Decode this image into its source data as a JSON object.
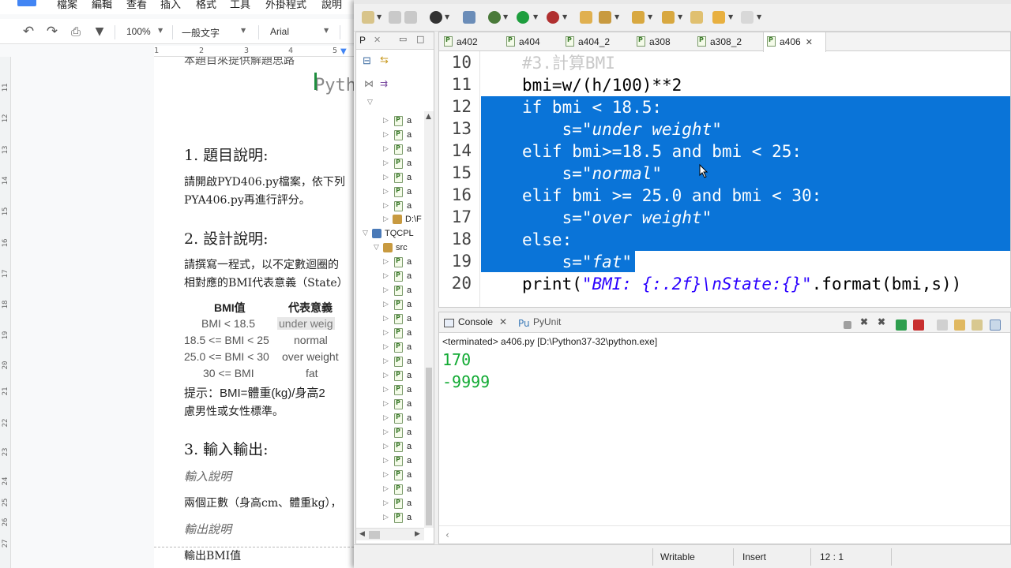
{
  "docs": {
    "menu": [
      "檔案",
      "編輯",
      "查看",
      "插入",
      "格式",
      "工具",
      "外掛程式",
      "說明"
    ],
    "toolbar": {
      "zoom": "100%",
      "style": "一般文字",
      "font": "Arial"
    },
    "ruler_numbers": [
      "1",
      "2",
      "3",
      "4",
      "5"
    ],
    "vruler_numbers": [
      "11",
      "12",
      "13",
      "14",
      "15",
      "16",
      "17",
      "18",
      "19",
      "20",
      "21",
      "22",
      "23",
      "24",
      "25",
      "26",
      "27"
    ],
    "page": {
      "top_cut": "本題目來提供解題思路",
      "title_cut": "Pyth",
      "h1": "1.  題目說明:",
      "p1_line1": "請開啟PYD406.py檔案，依下列",
      "p1_line2": "PYA406.py再進行評分。",
      "h2": "2.  設計說明:",
      "p2_line1": "請撰寫一程式，以不定數迴圈的",
      "p2_line2": "相對應的BMI代表意義（State）",
      "table": {
        "headers": [
          "BMI值",
          "代表意義"
        ],
        "rows": [
          [
            "BMI < 18.5",
            "under weig"
          ],
          [
            "18.5 <= BMI < 25",
            "normal"
          ],
          [
            "25.0 <= BMI < 30",
            "over weight"
          ],
          [
            "30 <= BMI",
            "fat"
          ]
        ]
      },
      "hint_line1": "提示：BMI=體重(kg)/身高2",
      "hint_line2": "慮男性或女性標準。",
      "h3": "3.  輸入輸出:",
      "sub_input": "輸入說明",
      "p3": "兩個正數（身高cm、體重kg），",
      "sub_output": "輸出說明",
      "p4": "輸出BMI值"
    }
  },
  "eclipse": {
    "package_explorer": {
      "tab_label": "P",
      "project_items": [
        "D:\\F",
        "TQCPL",
        "src"
      ],
      "file_row_label": "a"
    },
    "editor_tabs": [
      {
        "label": "a402",
        "active": false
      },
      {
        "label": "a404",
        "active": false
      },
      {
        "label": "a404_2",
        "active": false
      },
      {
        "label": "a308",
        "active": false
      },
      {
        "label": "a308_2",
        "active": false
      },
      {
        "label": "a406",
        "active": true
      }
    ],
    "code": {
      "line_numbers": [
        "10",
        "11",
        "12",
        "13",
        "14",
        "15",
        "16",
        "17",
        "18",
        "19",
        "20"
      ],
      "l10": "#3.計算BMI",
      "l11_a": "bmi=w/(h/",
      "l11_b": "100",
      "l11_c": ")**",
      "l11_d": "2",
      "l12": "if bmi < 18.5:",
      "l13_a": "    s=",
      "l13_b": "\"under weight\"",
      "l14": "elif bmi>=18.5 and bmi < 25:",
      "l15_a": "    s=",
      "l15_b": "\"normal\"",
      "l16": "elif bmi >= 25.0 and bmi < 30:",
      "l17_a": "    s=",
      "l17_b": "\"over weight\"",
      "l18": "else:",
      "l19_a": "    s=",
      "l19_b": "\"fat\"",
      "l20_a": "print(",
      "l20_b": "\"BMI: {:.2f}\\nState:{}\"",
      "l20_c": ".format(bmi,s))"
    },
    "console": {
      "tabs": [
        "Console",
        "PyUnit"
      ],
      "status": "<terminated> a406.py [D:\\Python37-32\\python.exe]",
      "output": [
        "170",
        "-9999"
      ]
    },
    "statusbar": {
      "mode": "Writable",
      "insert": "Insert",
      "position": "12 : 1"
    }
  }
}
